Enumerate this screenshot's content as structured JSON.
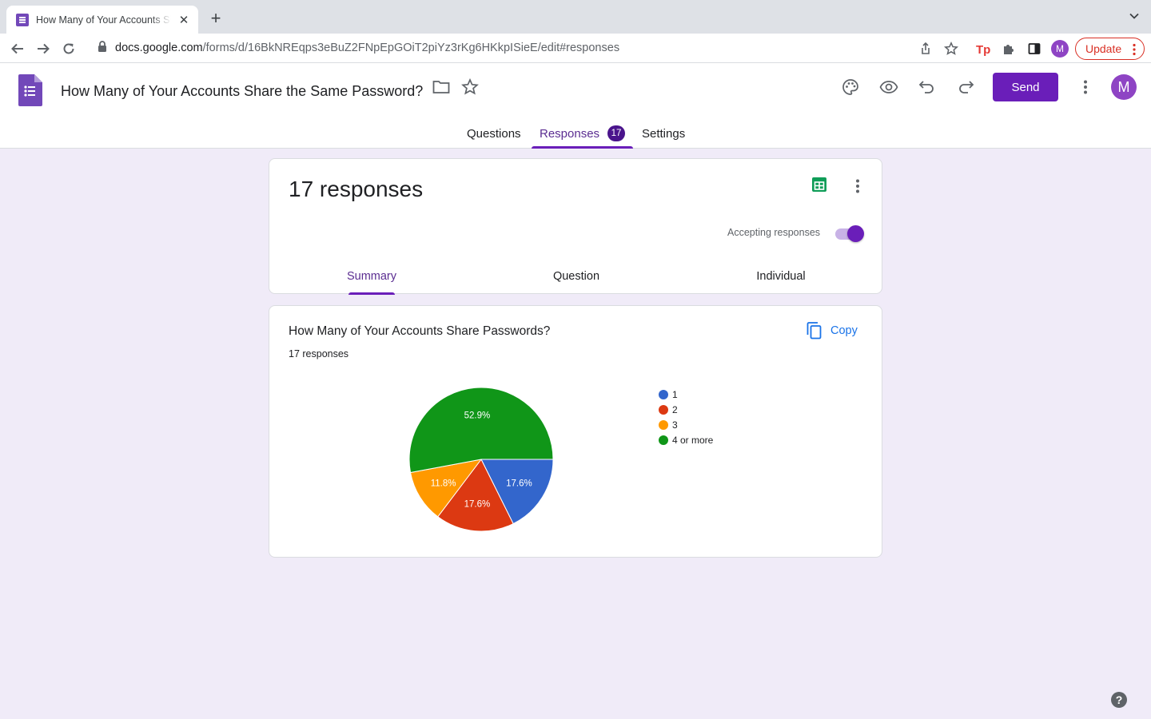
{
  "browser": {
    "tab_title": "How Many of Your Accounts Share the Same Password? - Google Forms",
    "tab_close": "✕",
    "new_tab": "+",
    "url_domain": "docs.google.com",
    "url_path": "/forms/d/16BkNREqps3eBuZ2FNpEpGOiT2piYz3rKg6HKkpISieE/edit#responses",
    "profile_initial": "M",
    "update_label": "Update"
  },
  "header": {
    "title": "How Many of Your Accounts Share the Same Password?",
    "send_label": "Send",
    "avatar_initial": "M"
  },
  "main_tabs": {
    "questions": "Questions",
    "responses": "Responses",
    "responses_badge": "17",
    "settings": "Settings"
  },
  "summary_card": {
    "count_label": "17 responses",
    "accepting_label": "Accepting responses",
    "accepting": true,
    "tabs": [
      "Summary",
      "Question",
      "Individual"
    ]
  },
  "question_card": {
    "title": "How Many of Your Accounts Share Passwords?",
    "response_count": "17 responses",
    "copy_label": "Copy"
  },
  "chart_data": {
    "type": "pie",
    "categories": [
      "1",
      "2",
      "3",
      "4 or more"
    ],
    "values": [
      3,
      3,
      2,
      9
    ],
    "labels": [
      "17.6%",
      "17.6%",
      "11.8%",
      "52.9%"
    ],
    "colors": [
      "#3366cc",
      "#dc3912",
      "#ff9900",
      "#109618"
    ],
    "legend": "right"
  },
  "help_label": "?"
}
